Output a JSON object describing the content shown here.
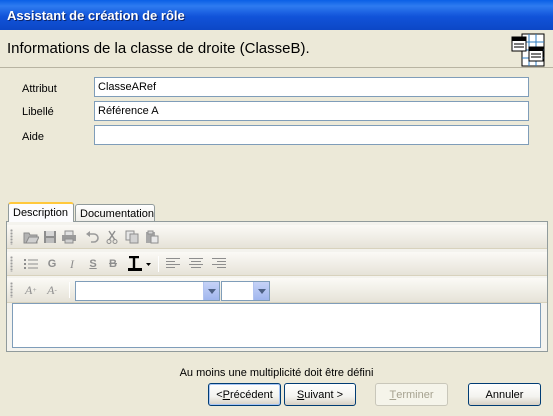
{
  "window": {
    "title": "Assistant de création de rôle"
  },
  "header": {
    "title": "Informations de la classe de droite (ClasseB).",
    "icon": "class-diagram-icon"
  },
  "form": {
    "fields": [
      {
        "label": "Attribut",
        "value": "ClasseARef",
        "placeholder": ""
      },
      {
        "label": "Libellé",
        "value": "Référence A",
        "placeholder": ""
      },
      {
        "label": "Aide",
        "value": "",
        "placeholder": ""
      }
    ]
  },
  "tabs": [
    {
      "label": "Description",
      "selected": true
    },
    {
      "label": "Documentation",
      "selected": false
    }
  ],
  "editor": {
    "toolbar1": [
      "open-icon",
      "save-icon",
      "print-icon",
      "undo-icon",
      "cut-icon",
      "copy-icon",
      "paste-icon"
    ],
    "toolbar2": {
      "bullets_icon": "bullet-list-icon",
      "bold": "G",
      "italic": "I",
      "strike_s": "S",
      "strike_b": "B",
      "text_color_icon": "text-color-icon",
      "align": [
        "align-left-icon",
        "align-center-icon",
        "align-right-icon"
      ]
    },
    "toolbar3": {
      "font_grow": "A",
      "font_shrink": "A",
      "font_name": "",
      "font_size": ""
    },
    "content": ""
  },
  "footer": {
    "message": "Au moins une multiplicité doit être défini",
    "buttons": {
      "back": "< Précédent",
      "next": "Suivant >",
      "finish": "Terminer",
      "cancel": "Annuler"
    }
  },
  "colors": {
    "titlebar": "#0A5FE6",
    "dialog_bg": "#ECE9D8",
    "tab_highlight": "#FFC83C",
    "input_border": "#7F9DB9"
  }
}
